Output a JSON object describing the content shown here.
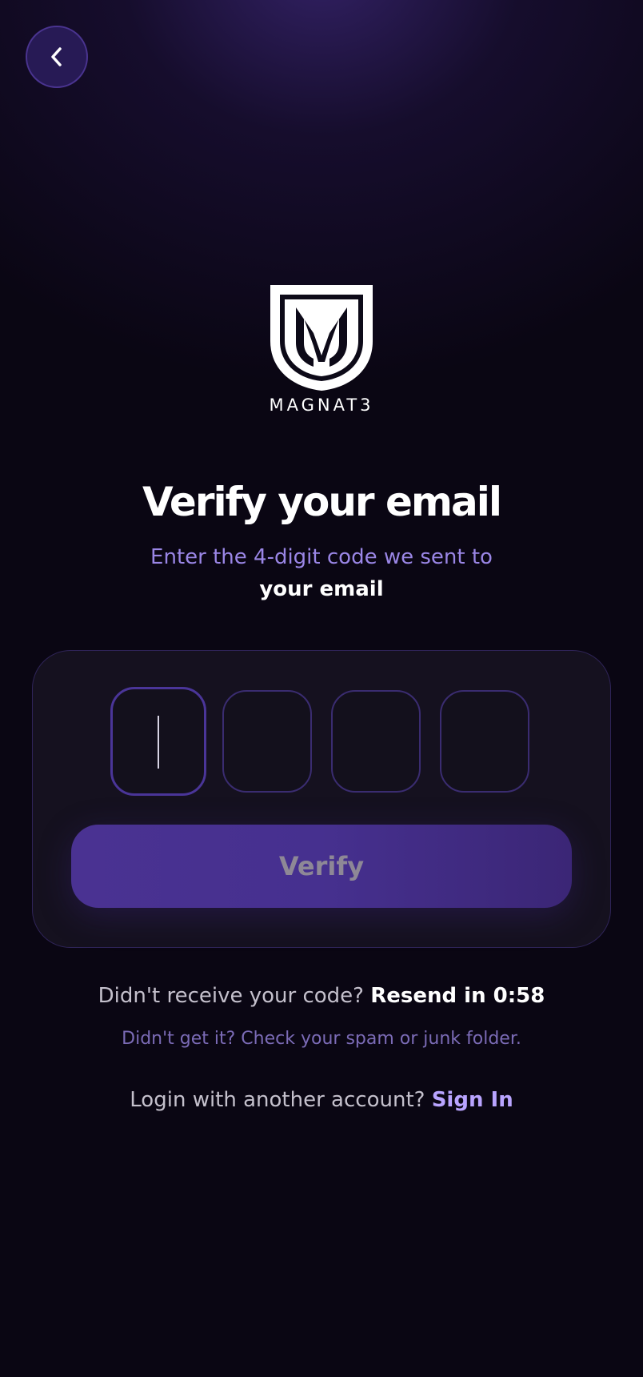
{
  "header": {
    "back_icon": "chevron-left-icon"
  },
  "brand": {
    "logo_icon": "magnat3-shield-logo",
    "name": "MAGNAT3"
  },
  "verify": {
    "title": "Verify your email",
    "subtitle": "Enter the 4-digit code we sent to",
    "email_label": "your email",
    "code_digits": [
      "",
      "",
      "",
      ""
    ],
    "active_digit_index": 0,
    "button_label": "Verify"
  },
  "resend": {
    "prompt": "Didn't receive your code?",
    "action_label": "Resend in 0:58",
    "hint": "Didn't get it? Check your spam or junk folder."
  },
  "signin": {
    "prompt": "Login with another account?",
    "action_label": "Sign In"
  },
  "colors": {
    "background": "#0a0613",
    "accent": "#4a3292",
    "accent_text": "#b9a4ff",
    "subtitle": "#9a86e6"
  }
}
